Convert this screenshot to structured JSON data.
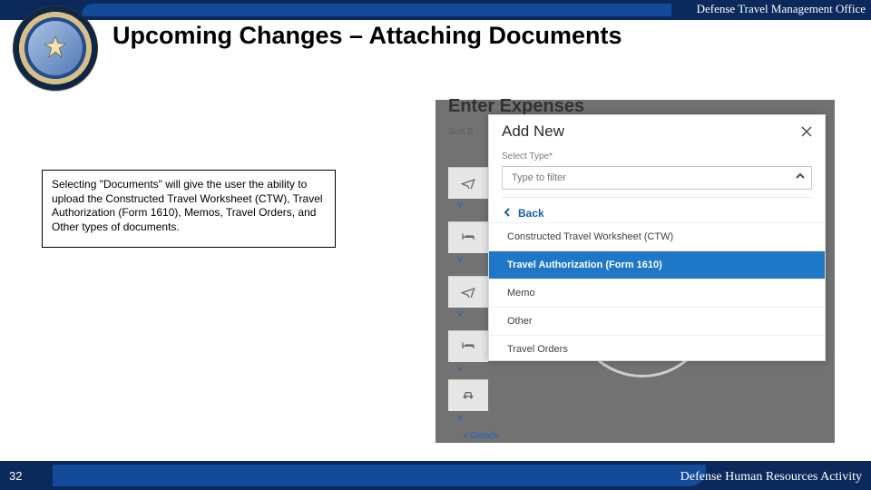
{
  "header": {
    "org_label": "Defense Travel Management Office"
  },
  "slide": {
    "title": "Upcoming Changes – Attaching Documents",
    "caption": "Selecting \"Documents\" will give the user the ability to upload the Constructed Travel Worksheet (CTW), Travel Authorization (Form 1610), Memos, Travel Orders, and Other types of documents.",
    "page_number": "32"
  },
  "footer": {
    "org_label": "Defense Human Resources Activity"
  },
  "app": {
    "screen_title": "Enter Expenses",
    "sort_label": "Sort B",
    "details_label": "Details",
    "modal": {
      "title": "Add New",
      "select_label": "Select Type*",
      "filter_placeholder": "Type to filter",
      "back_label": "Back",
      "options": [
        {
          "label": "Constructed Travel Worksheet (CTW)",
          "selected": false
        },
        {
          "label": "Travel Authorization (Form 1610)",
          "selected": true
        },
        {
          "label": "Memo",
          "selected": false
        },
        {
          "label": "Other",
          "selected": false
        },
        {
          "label": "Travel Orders",
          "selected": false
        }
      ]
    }
  }
}
